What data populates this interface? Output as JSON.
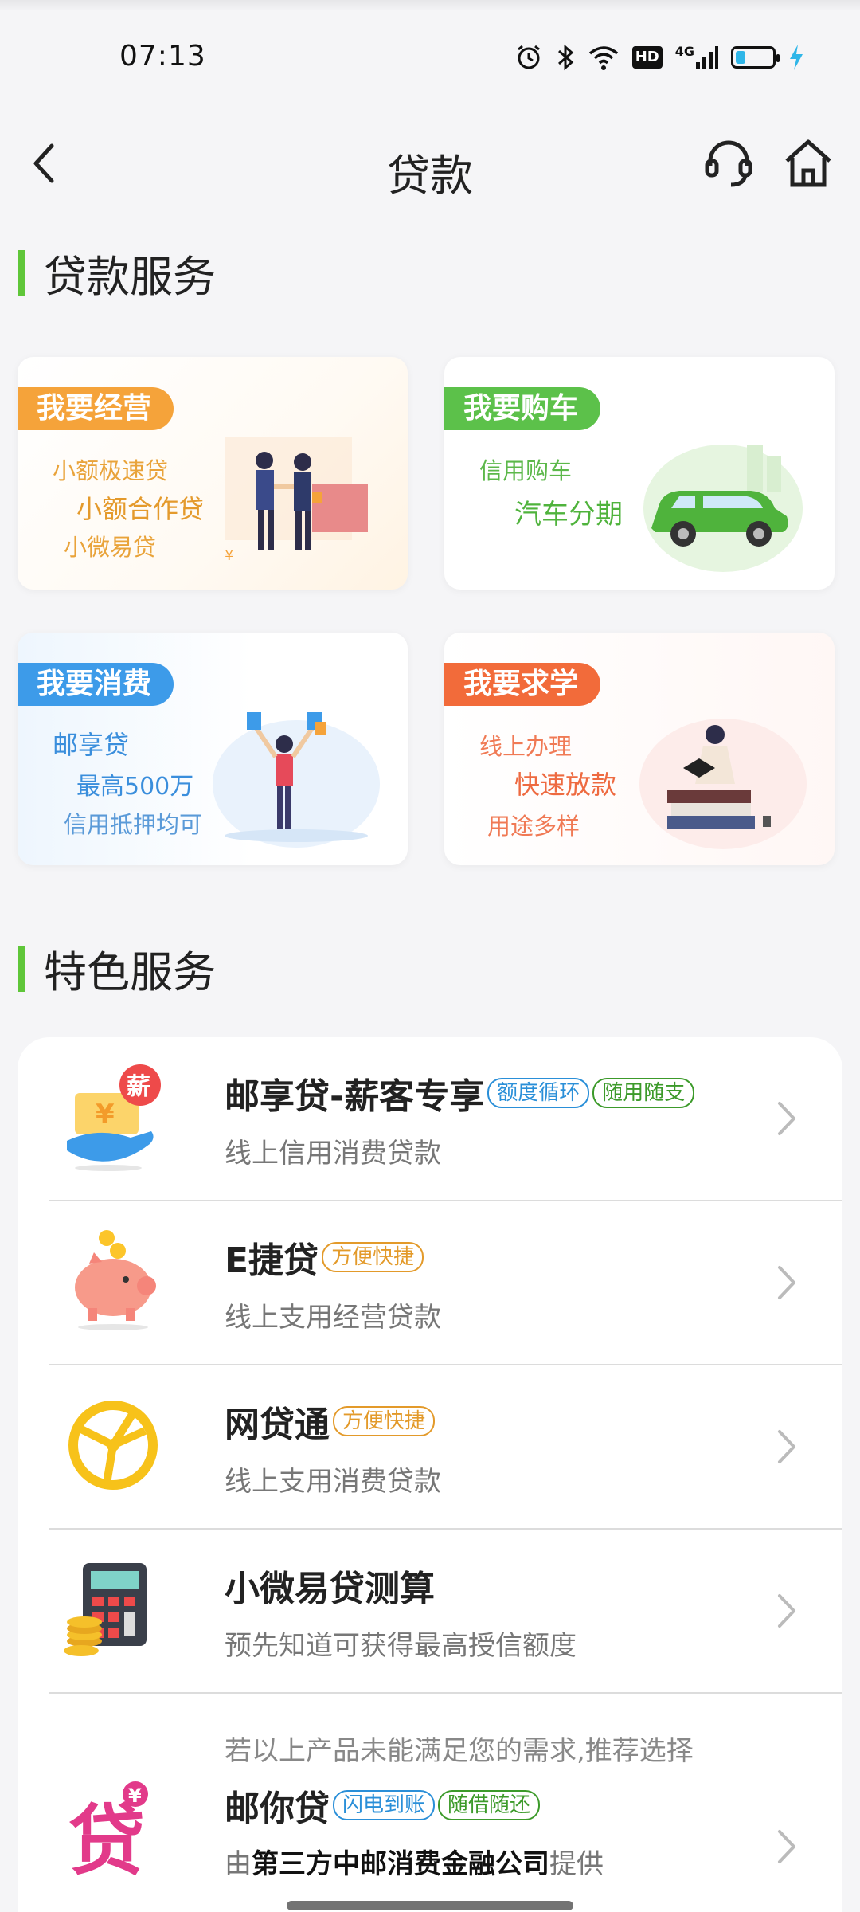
{
  "status_bar": {
    "time": "07:13",
    "hd_label": "HD",
    "net_label": "4G",
    "icons": [
      "alarm-icon",
      "bluetooth-icon",
      "wifi-icon",
      "hd-icon",
      "signal-icon",
      "battery-icon",
      "charging-icon"
    ]
  },
  "header": {
    "title": "贷款",
    "icons": [
      "back-icon",
      "customer-service-icon",
      "home-icon"
    ]
  },
  "loan_services": {
    "title": "贷款服务",
    "cards": [
      {
        "tag": "我要经营",
        "lines": [
          "小额极速贷",
          "小额合作贷",
          "小微易贷"
        ],
        "color": "#f5a33a"
      },
      {
        "tag": "我要购车",
        "lines": [
          "信用购车",
          "汽车分期"
        ],
        "color": "#5cc14a"
      },
      {
        "tag": "我要消费",
        "lines": [
          "邮享贷",
          "最高500万",
          "信用抵押均可"
        ],
        "color": "#3d9be9"
      },
      {
        "tag": "我要求学",
        "lines": [
          "线上办理",
          "快速放款",
          "用途多样"
        ],
        "color": "#f26b3a"
      }
    ]
  },
  "featured_services": {
    "title": "特色服务",
    "items": [
      {
        "title": "邮享贷-薪客专享",
        "badges": [
          "额度循环",
          "随用随支"
        ],
        "desc": "线上信用消费贷款",
        "icon": "salary-hand-icon"
      },
      {
        "title": "E捷贷",
        "badges": [
          "方便快捷"
        ],
        "desc": "线上支用经营贷款",
        "icon": "piggy-bank-icon"
      },
      {
        "title": "网贷通",
        "badges": [
          "方便快捷"
        ],
        "desc": "线上支用消费贷款",
        "icon": "globe-icon"
      },
      {
        "title": "小微易贷测算",
        "badges": [],
        "desc": "预先知道可获得最高授信额度",
        "icon": "calculator-icon"
      },
      {
        "note": "若以上产品未能满足您的需求,推荐选择",
        "title": "邮你贷",
        "badges": [
          "闪电到账",
          "随借随还"
        ],
        "provider_prefix": "由",
        "provider_name": "第三方中邮消费金融公司",
        "provider_suffix": "提供",
        "icon": "loan-char-icon"
      }
    ]
  },
  "colors": {
    "accent_green": "#5fc639",
    "badge_blue": "#2a8fd8",
    "badge_green": "#3c9a2a",
    "badge_orange": "#e39a2a"
  }
}
